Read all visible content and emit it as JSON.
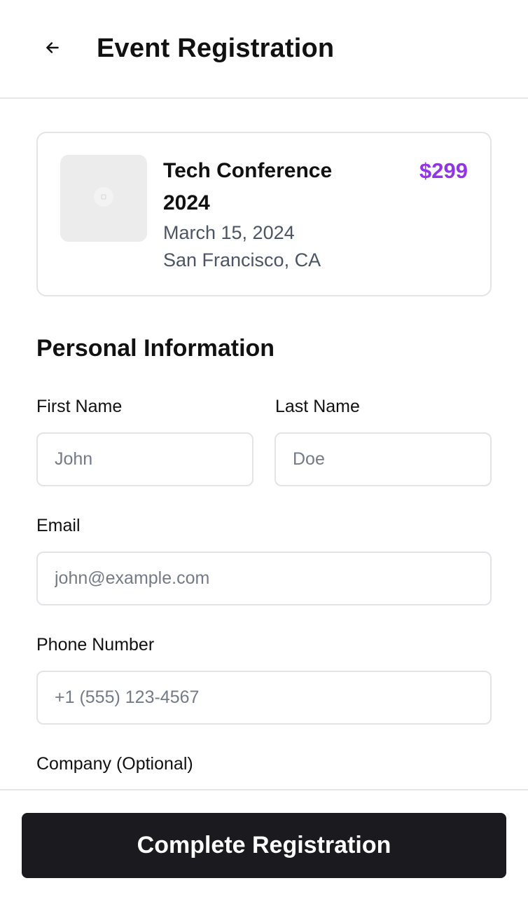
{
  "header": {
    "title": "Event Registration",
    "back_icon": "arrow-left-icon"
  },
  "event": {
    "title": "Tech Conference 2024",
    "date": "March 15, 2024",
    "location": "San Francisco, CA",
    "price": "$299",
    "image_icon": "image-placeholder-icon"
  },
  "form": {
    "section_title": "Personal Information",
    "first_name": {
      "label": "First Name",
      "placeholder": "John",
      "value": ""
    },
    "last_name": {
      "label": "Last Name",
      "placeholder": "Doe",
      "value": ""
    },
    "email": {
      "label": "Email",
      "placeholder": "john@example.com",
      "value": ""
    },
    "phone": {
      "label": "Phone Number",
      "placeholder": "+1 (555) 123-4567",
      "value": ""
    },
    "company": {
      "label": "Company (Optional)"
    }
  },
  "footer": {
    "submit_label": "Complete Registration"
  },
  "colors": {
    "accent": "#9333ea",
    "primary_button": "#1b1b1f",
    "muted_text": "#4b5566",
    "border": "#e3e4e8"
  }
}
